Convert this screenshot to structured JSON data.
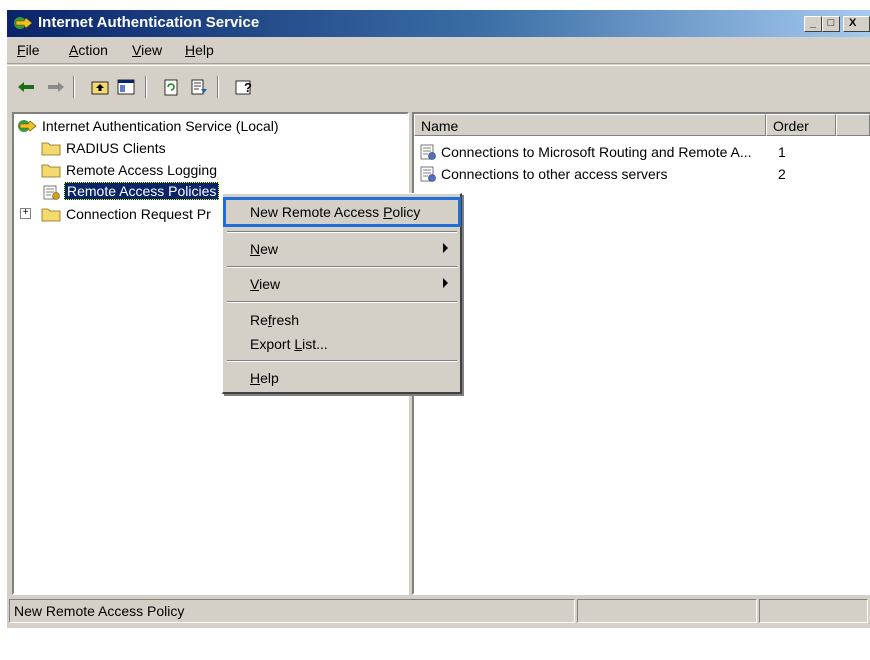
{
  "window": {
    "title": "Internet Authentication Service",
    "controls": {
      "minimize": "_",
      "maximize": "□",
      "close": "X"
    }
  },
  "menubar": {
    "items": [
      {
        "label": "File",
        "ul": "F",
        "rest": "ile"
      },
      {
        "label": "Action",
        "ul": "A",
        "rest": "ction"
      },
      {
        "label": "View",
        "ul": "V",
        "rest": "iew"
      },
      {
        "label": "Help",
        "ul": "H",
        "rest": "elp"
      }
    ]
  },
  "toolbar": {
    "buttons": [
      "back-arrow-icon",
      "forward-arrow-icon",
      "up-folder-icon",
      "show-hide-tree-icon",
      "refresh-icon",
      "export-list-icon",
      "help-icon"
    ]
  },
  "tree": {
    "root": "Internet Authentication Service (Local)",
    "children": [
      {
        "label": "RADIUS Clients",
        "icon": "folder-icon"
      },
      {
        "label": "Remote Access Logging",
        "icon": "folder-icon"
      },
      {
        "label": "Remote Access Policies",
        "icon": "policy-icon",
        "selected": true
      },
      {
        "label": "Connection Request Pr",
        "icon": "folder-icon",
        "expandable": true
      }
    ]
  },
  "list": {
    "columns": [
      "Name",
      "Order"
    ],
    "rows": [
      {
        "name": "Connections to Microsoft Routing and Remote A...",
        "order": "1"
      },
      {
        "name": "Connections to other access servers",
        "order": "2"
      }
    ]
  },
  "context_menu": {
    "items": [
      {
        "pre": "New Remote Access ",
        "ul": "P",
        "post": "olicy",
        "highlighted": true
      },
      {
        "pre": "",
        "ul": "N",
        "post": "ew",
        "submenu": true
      },
      {
        "pre": "",
        "ul": "V",
        "post": "iew",
        "submenu": true
      },
      {
        "pre": "Re",
        "ul": "f",
        "post": "resh"
      },
      {
        "pre": "Export ",
        "ul": "L",
        "post": "ist..."
      },
      {
        "pre": "",
        "ul": "H",
        "post": "elp"
      }
    ]
  },
  "statusbar": {
    "text": "New Remote Access Policy"
  },
  "colors": {
    "title_start": "#0a246a",
    "selection": "#0a246a",
    "highlight_outline": "#1f6fd6",
    "chrome": "#d4d0c8"
  }
}
